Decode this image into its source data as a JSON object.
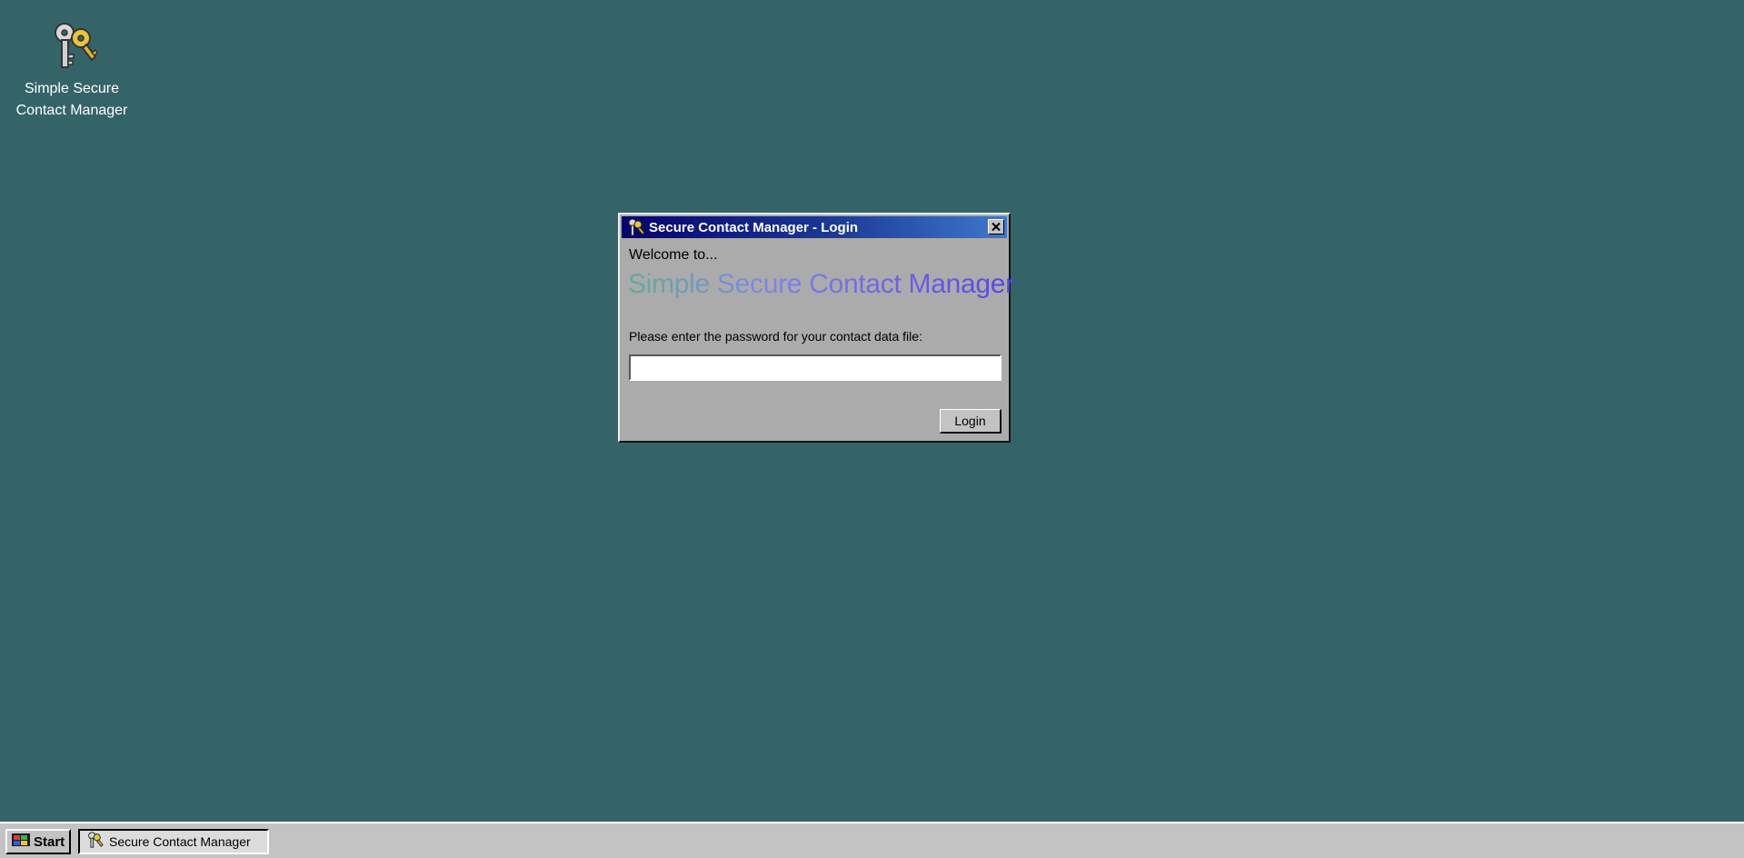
{
  "colors": {
    "desktop": "#356468",
    "window_face": "#ababab",
    "titlebar_start": "#06026e",
    "titlebar_end": "#3f78ce"
  },
  "desktop_icon": {
    "label_line1": "Simple Secure",
    "label_line2": "Contact Manager",
    "icon": "keys-icon"
  },
  "login_window": {
    "title": "Secure Contact Manager - Login",
    "title_icon": "keys-icon",
    "close_icon": "close-icon",
    "welcome_text": "Welcome to...",
    "app_name": "Simple Secure Contact Manager",
    "password_prompt": "Please enter the password for your contact data file:",
    "password_value": "",
    "login_button": "Login"
  },
  "taskbar": {
    "start_label": "Start",
    "start_icon": "windows-logo-icon",
    "task_icon": "keys-icon",
    "task_label": "Secure Contact Manager"
  }
}
